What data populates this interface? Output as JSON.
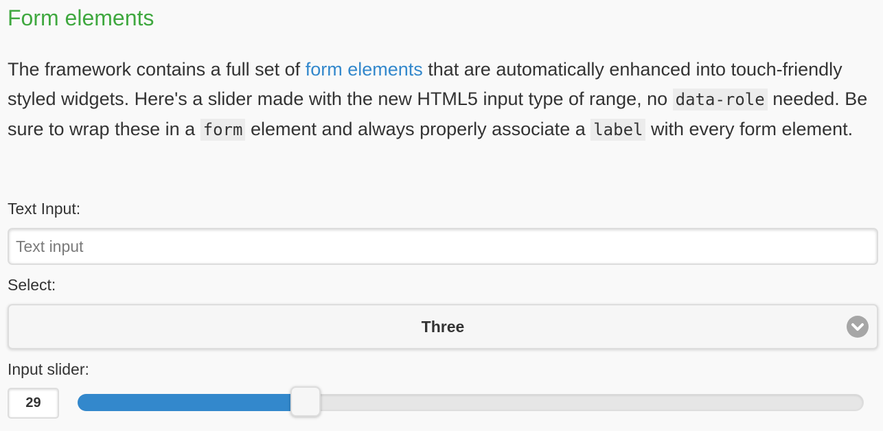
{
  "section": {
    "heading": "Form elements"
  },
  "intro": {
    "t1": "The framework contains a full set of ",
    "link": "form elements",
    "t2": " that are automatically enhanced into touch-friendly styled widgets. Here's a slider made with the new HTML5 input type of range, no ",
    "code1": "data-role",
    "t3": " needed. Be sure to wrap these in a ",
    "code2": "form",
    "t4": " element and always properly associate a ",
    "code3": "label",
    "t5": " with every form element."
  },
  "form": {
    "text_input": {
      "label": "Text Input:",
      "placeholder": "Text input",
      "value": ""
    },
    "select": {
      "label": "Select:",
      "selected": "Three",
      "icon": "chevron-down-icon"
    },
    "slider": {
      "label": "Input slider:",
      "value": "29",
      "min": 0,
      "max": 100,
      "fill_color": "#3388cc"
    }
  },
  "colors": {
    "heading": "#3fa83f",
    "link": "#3388cc",
    "background": "#f9f9f9"
  }
}
